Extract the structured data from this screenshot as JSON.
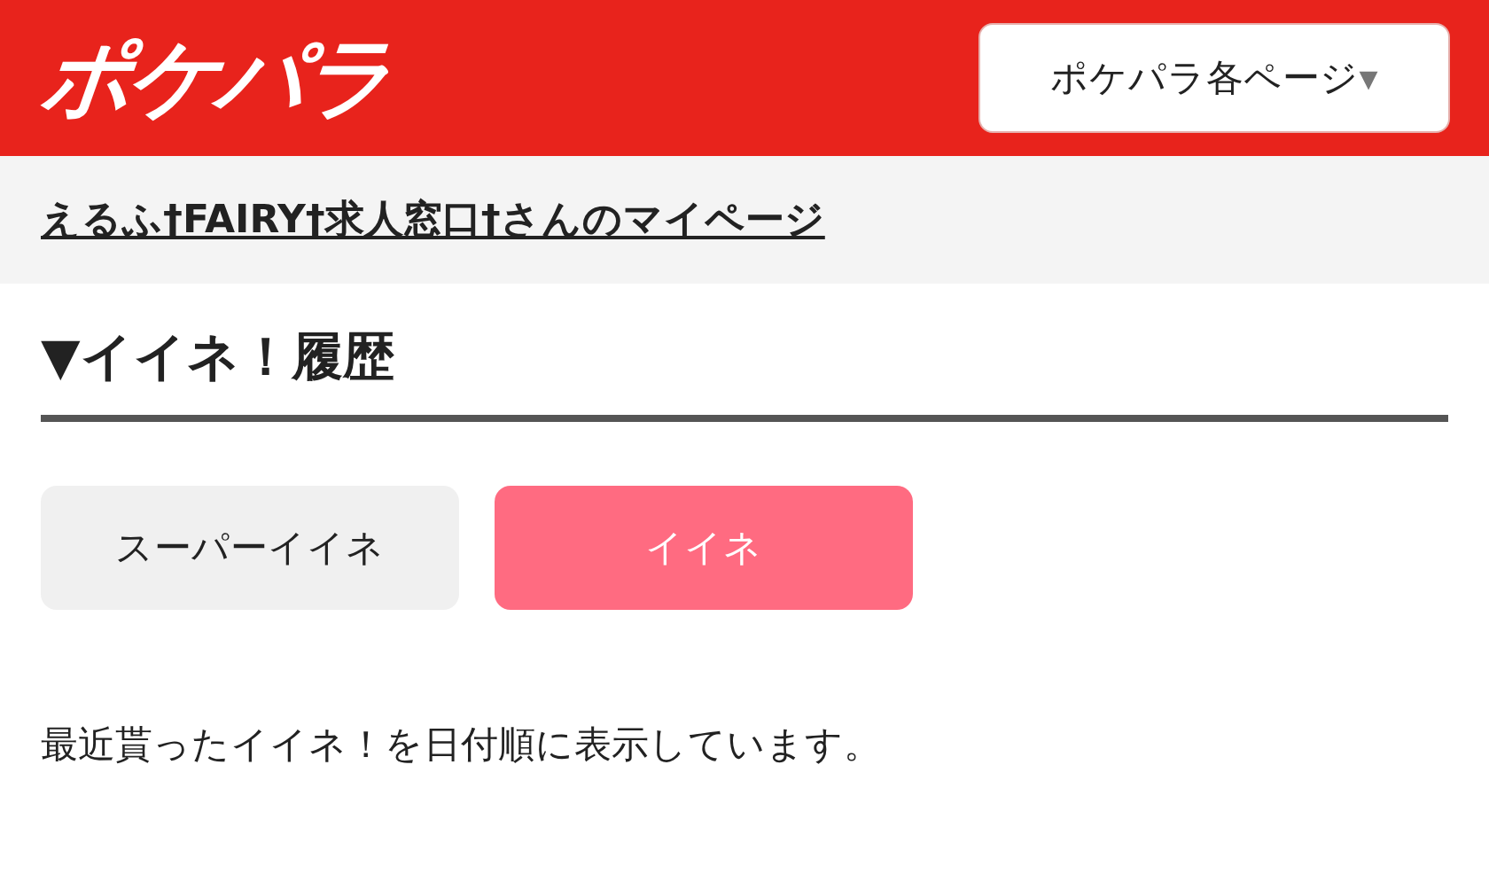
{
  "header": {
    "logo": "ポケパラ",
    "menu": {
      "label": "ポケパラ各ページ",
      "caret": "▾"
    }
  },
  "mypage_link": "えるふ†FAIRY†求人窓口†さんのマイページ",
  "heading": "▼イイネ！履歴",
  "tabs": [
    {
      "label": "スーパーイイネ",
      "selected": false
    },
    {
      "label": "イイネ",
      "selected": true
    }
  ],
  "description": "最近貰ったイイネ！を日付順に表示しています。"
}
